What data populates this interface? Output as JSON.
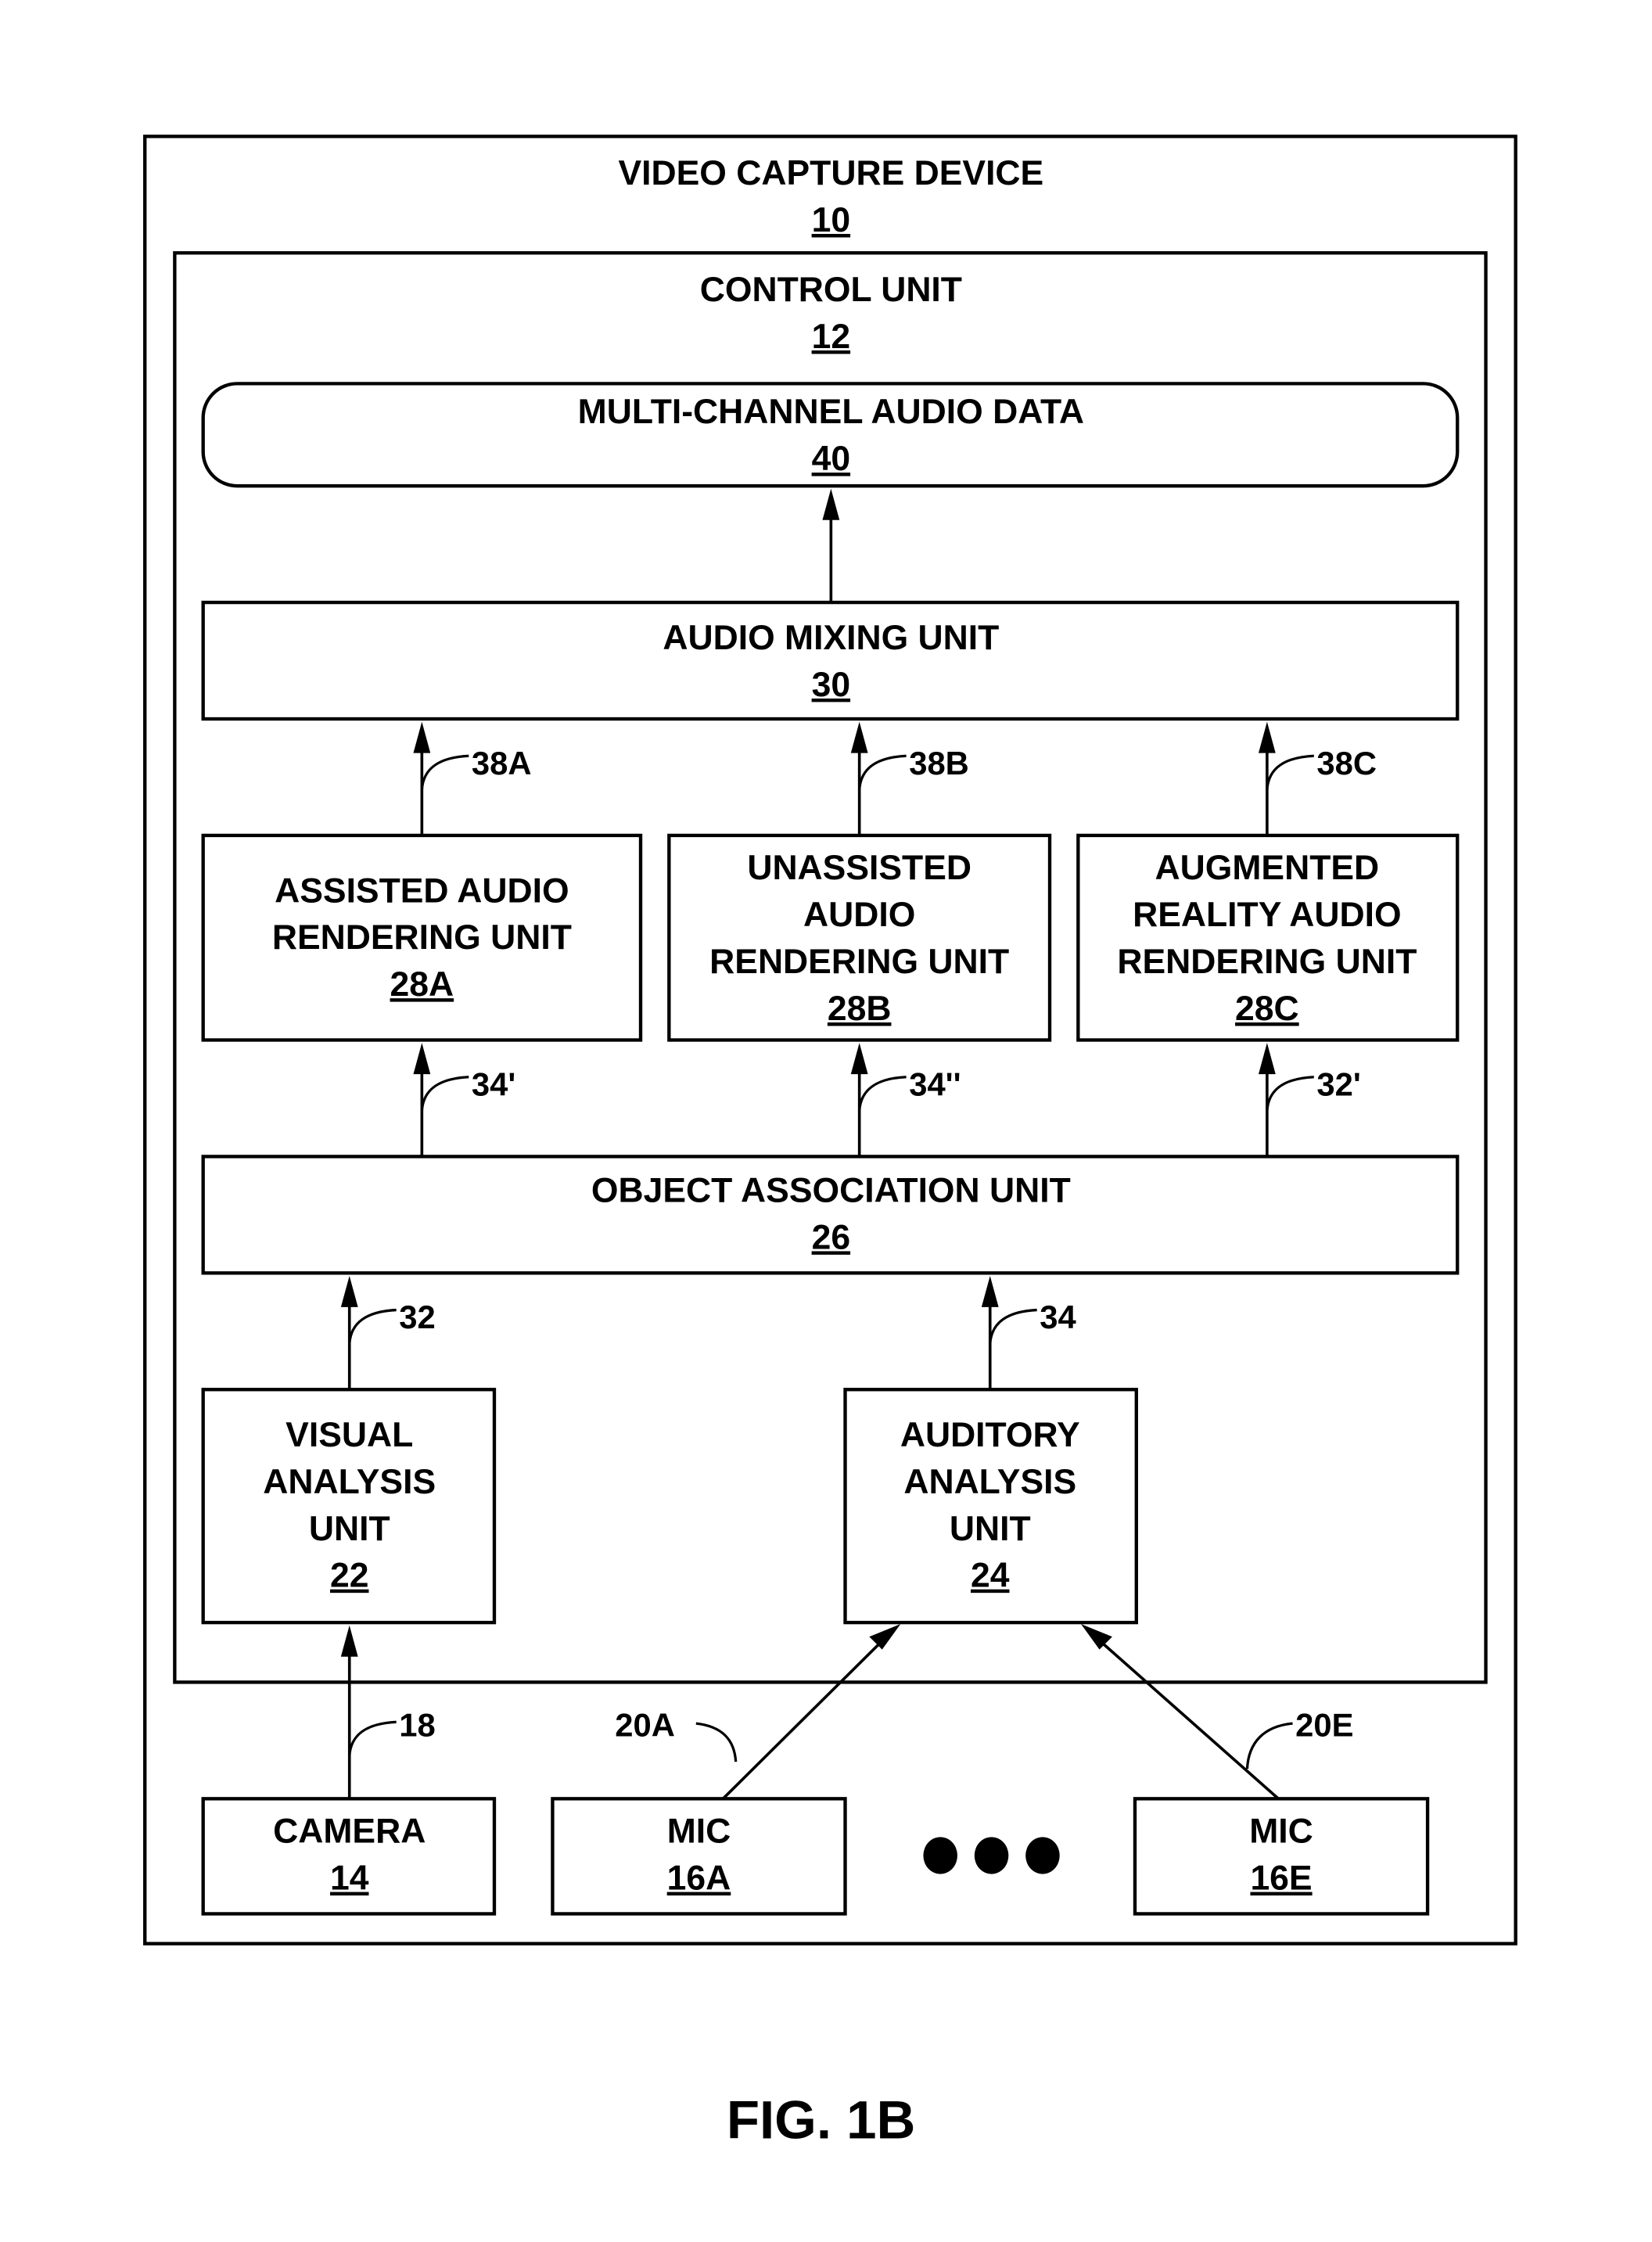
{
  "figure_label": "FIG. 1B",
  "colors": {
    "stroke": "#000000",
    "background": "#ffffff"
  },
  "device": {
    "title": "VIDEO CAPTURE DEVICE",
    "ref": "10"
  },
  "control_unit": {
    "title": "CONTROL UNIT",
    "ref": "12"
  },
  "blocks": {
    "multichannel": {
      "lines": [
        "MULTI-CHANNEL AUDIO DATA"
      ],
      "ref": "40"
    },
    "mixing": {
      "lines": [
        "AUDIO MIXING UNIT"
      ],
      "ref": "30"
    },
    "assisted": {
      "lines": [
        "ASSISTED AUDIO",
        "RENDERING UNIT"
      ],
      "ref": "28A"
    },
    "unassisted": {
      "lines": [
        "UNASSISTED",
        "AUDIO",
        "RENDERING UNIT"
      ],
      "ref": "28B"
    },
    "augmented": {
      "lines": [
        "AUGMENTED",
        "REALITY AUDIO",
        "RENDERING UNIT"
      ],
      "ref": "28C"
    },
    "object_assoc": {
      "lines": [
        "OBJECT ASSOCIATION UNIT"
      ],
      "ref": "26"
    },
    "visual": {
      "lines": [
        "VISUAL",
        "ANALYSIS",
        "UNIT"
      ],
      "ref": "22"
    },
    "auditory": {
      "lines": [
        "AUDITORY",
        "ANALYSIS",
        "UNIT"
      ],
      "ref": "24"
    },
    "camera": {
      "lines": [
        "CAMERA"
      ],
      "ref": "14"
    },
    "mic_a": {
      "lines": [
        "MIC"
      ],
      "ref": "16A"
    },
    "mic_e": {
      "lines": [
        "MIC"
      ],
      "ref": "16E"
    }
  },
  "signals": {
    "s38a": "38A",
    "s38b": "38B",
    "s38c": "38C",
    "s34p": "34'",
    "s34pp": "34''",
    "s32p": "32'",
    "s32": "32",
    "s34": "34",
    "s18": "18",
    "s20a": "20A",
    "s20e": "20E"
  },
  "ellipsis": "more-mics-ellipsis"
}
